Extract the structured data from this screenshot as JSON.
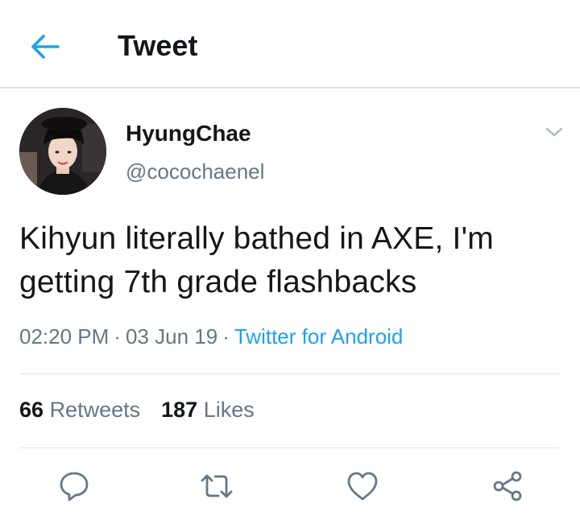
{
  "header": {
    "title": "Tweet"
  },
  "author": {
    "display_name": "HyungChae",
    "handle": "@cocochaenel"
  },
  "tweet": {
    "text_line1": "Kihyun literally bathed in AXE, I'm",
    "text_line2": "getting 7th grade flashbacks",
    "time": "02:20 PM",
    "date": "03 Jun 19",
    "separator": "·",
    "source": "Twitter for Android"
  },
  "stats": {
    "retweets_count": "66",
    "retweets_label": "Retweets",
    "likes_count": "187",
    "likes_label": "Likes"
  },
  "colors": {
    "accent": "#1da1f2",
    "secondary_text": "#657786",
    "divider": "#dfe3e6"
  },
  "icons": [
    "back-arrow-icon",
    "chevron-down-icon",
    "reply-icon",
    "retweet-icon",
    "like-icon",
    "share-icon"
  ]
}
